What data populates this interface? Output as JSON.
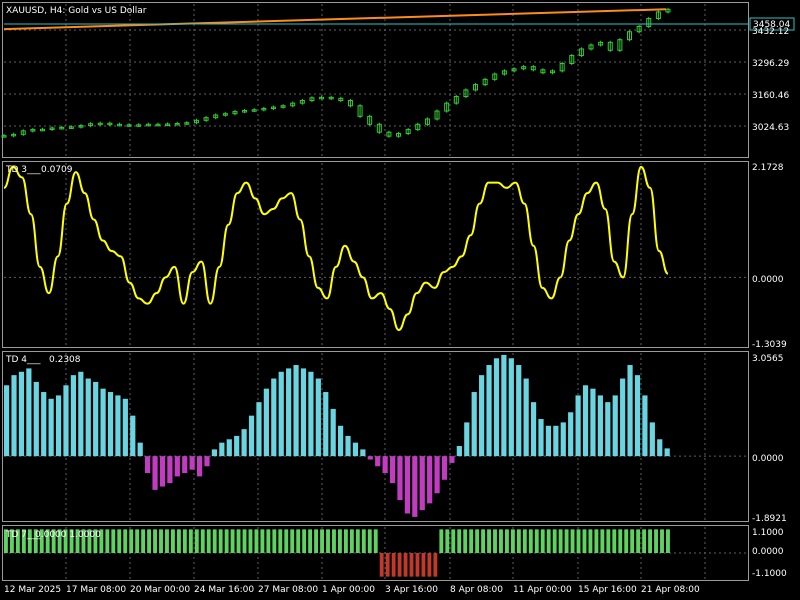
{
  "window": {
    "symbol_title": "XAUUSD, H4:  Gold vs US Dollar",
    "current_price": "3458.04"
  },
  "colors": {
    "background": "#000000",
    "grid": "#5f5f5f",
    "candles": "#32cd32",
    "trend_line": "#ff8c1a",
    "price_line": "#2ec4c4",
    "td3_line": "#ffff00",
    "td4_positive": "#6ad4e0",
    "td4_negative": "#c23cc2",
    "td7_positive": "#5fd35f",
    "td7_negative": "#c0392b",
    "text": "#ffffff"
  },
  "price_panel": {
    "axis_labels": [
      "3432.12",
      "3296.29",
      "3160.46",
      "3024.63"
    ],
    "price_range": [
      2910,
      3485
    ],
    "trend_line": {
      "start": 3390,
      "end": 3465
    },
    "price_path": [
      2987,
      2992,
      3005,
      3010,
      3011,
      3016,
      3018,
      3020,
      3025,
      3032,
      3034,
      3030,
      3028,
      3026,
      3028,
      3030,
      3029,
      3031,
      3033,
      3036,
      3045,
      3055,
      3065,
      3070,
      3078,
      3082,
      3085,
      3090,
      3095,
      3100,
      3110,
      3120,
      3130,
      3132,
      3128,
      3120,
      3100,
      3060,
      3030,
      3000,
      2985,
      2995,
      3010,
      3030,
      3050,
      3080,
      3110,
      3135,
      3160,
      3180,
      3200,
      3220,
      3232,
      3240,
      3248,
      3236,
      3225,
      3232,
      3260,
      3290,
      3315,
      3330,
      3340,
      3310,
      3350,
      3380,
      3400,
      3430,
      3455,
      3465
    ]
  },
  "td3_panel": {
    "label": "TD 3___",
    "value": "0.0709",
    "axis_labels": [
      "2.1728",
      "0.0000",
      "-1.3039"
    ],
    "range": [
      -1.3039,
      2.1728
    ],
    "values": [
      1.7,
      2.1,
      1.9,
      1.2,
      0.2,
      -0.3,
      0.4,
      1.4,
      2.0,
      1.6,
      1.1,
      0.7,
      0.5,
      0.4,
      -0.1,
      -0.4,
      -0.5,
      -0.3,
      0.0,
      0.2,
      -0.5,
      0.1,
      0.3,
      -0.5,
      0.2,
      1.0,
      1.6,
      1.8,
      1.5,
      1.2,
      1.3,
      1.5,
      1.6,
      1.1,
      0.4,
      -0.2,
      -0.4,
      0.2,
      0.6,
      0.3,
      0.0,
      -0.4,
      -0.3,
      -0.6,
      -1.0,
      -0.7,
      -0.3,
      -0.1,
      -0.2,
      0.1,
      0.2,
      0.4,
      0.8,
      1.4,
      1.8,
      1.8,
      1.7,
      1.8,
      1.4,
      0.6,
      -0.2,
      -0.4,
      0.0,
      0.7,
      1.2,
      1.6,
      1.8,
      1.3,
      0.3,
      0.0,
      1.2,
      2.1,
      1.7,
      0.5,
      0.07
    ]
  },
  "td4_panel": {
    "label": "TD 4___",
    "value": "0.2308",
    "axis_labels": [
      "3.0565",
      "0.0000",
      "-1.8921"
    ],
    "range": [
      -1.8921,
      3.0565
    ],
    "values": [
      2.1,
      2.4,
      2.5,
      2.6,
      2.2,
      1.9,
      1.7,
      1.8,
      2.1,
      2.4,
      2.5,
      2.3,
      2.2,
      2.0,
      1.9,
      1.8,
      1.7,
      1.2,
      0.4,
      -0.5,
      -1.0,
      -0.9,
      -0.8,
      -0.6,
      -0.5,
      -0.4,
      -0.6,
      -0.3,
      0.2,
      0.4,
      0.5,
      0.6,
      0.8,
      1.2,
      1.6,
      2.0,
      2.3,
      2.5,
      2.6,
      2.7,
      2.6,
      2.5,
      2.3,
      1.9,
      1.4,
      0.9,
      0.6,
      0.4,
      0.2,
      -0.1,
      -0.3,
      -0.5,
      -0.8,
      -1.3,
      -1.7,
      -1.8,
      -1.6,
      -1.4,
      -1.1,
      -0.7,
      -0.2,
      0.3,
      1.0,
      1.9,
      2.4,
      2.7,
      2.9,
      3.0,
      2.9,
      2.7,
      2.3,
      1.6,
      1.1,
      0.9,
      0.9,
      1.0,
      1.3,
      1.8,
      2.1,
      2.0,
      1.8,
      1.6,
      1.8,
      2.3,
      2.7,
      2.4,
      1.8,
      1.0,
      0.5,
      0.23
    ]
  },
  "td7_panel": {
    "label": "TD 7___",
    "values_text": "0.0000 1.0000",
    "axis_labels": [
      "1.1000",
      "0.0000",
      "-1.1000"
    ],
    "range": [
      -1.1,
      1.1
    ],
    "signal": [
      1,
      1,
      1,
      1,
      1,
      1,
      1,
      1,
      1,
      1,
      1,
      1,
      1,
      1,
      1,
      1,
      1,
      1,
      1,
      1,
      1,
      1,
      1,
      1,
      1,
      1,
      1,
      1,
      1,
      1,
      1,
      1,
      1,
      1,
      1,
      1,
      1,
      1,
      1,
      1,
      1,
      1,
      1,
      1,
      1,
      1,
      1,
      1,
      1,
      1,
      1,
      1,
      1,
      1,
      1,
      1,
      1,
      1,
      1,
      1,
      1,
      1,
      1,
      -1,
      -1,
      -1,
      -1,
      -1,
      -1,
      -1,
      -1,
      -1,
      -1,
      1,
      1,
      1,
      1,
      1,
      1,
      1,
      1,
      1,
      1,
      1,
      1,
      1,
      1,
      1,
      1,
      1,
      1,
      1,
      1,
      1,
      1,
      1,
      1,
      1,
      1,
      1,
      1,
      1,
      1,
      1,
      1,
      1,
      1,
      1,
      1,
      1,
      1,
      1
    ]
  },
  "time_axis": [
    "12 Mar 2025",
    "17 Mar 08:00",
    "20 Mar 00:00",
    "24 Mar 16:00",
    "27 Mar 08:00",
    "1 Apr 00:00",
    "3 Apr 16:00",
    "8 Apr 08:00",
    "11 Apr 00:00",
    "15 Apr 16:00",
    "21 Apr 08:00"
  ]
}
